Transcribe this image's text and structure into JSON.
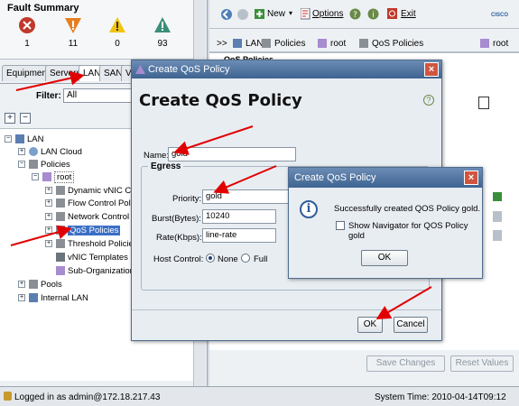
{
  "fault_summary": {
    "title": "Fault Summary",
    "items": [
      {
        "icon": "critical-icon",
        "count": "1",
        "color": "#c0392b"
      },
      {
        "icon": "major-icon",
        "count": "11",
        "color": "#e67e22"
      },
      {
        "icon": "minor-icon",
        "count": "0",
        "color": "#f1c40f"
      },
      {
        "icon": "warning-icon",
        "count": "93",
        "color": "#3a8f7a"
      }
    ]
  },
  "nav_tabs": [
    "Equipment",
    "Servers",
    "LAN",
    "SAN",
    "V"
  ],
  "filter": {
    "label": "Filter:",
    "value": "All"
  },
  "tree": [
    {
      "label": "LAN",
      "level": 0,
      "toggle": "-"
    },
    {
      "label": "LAN Cloud",
      "level": 1,
      "toggle": "+"
    },
    {
      "label": "Policies",
      "level": 1,
      "toggle": "-"
    },
    {
      "label": "root",
      "level": 2,
      "toggle": "-"
    },
    {
      "label": "Dynamic vNIC Cor",
      "level": 3,
      "toggle": "+"
    },
    {
      "label": "Flow Control Polic",
      "level": 3,
      "toggle": "+"
    },
    {
      "label": "Network Control P",
      "level": 3,
      "toggle": "+"
    },
    {
      "label": "QoS Policies",
      "level": 3,
      "toggle": "+",
      "selected": true
    },
    {
      "label": "Threshold Policies",
      "level": 3,
      "toggle": "+"
    },
    {
      "label": "vNIC Templates",
      "level": 3,
      "toggle": ""
    },
    {
      "label": "Sub-Organizations",
      "level": 3,
      "toggle": ""
    },
    {
      "label": "Pools",
      "level": 1,
      "toggle": "+"
    },
    {
      "label": "Internal LAN",
      "level": 1,
      "toggle": "+"
    }
  ],
  "toolbar": {
    "new": "New",
    "options": "Options",
    "exit": "Exit",
    "brand": "CISCO"
  },
  "breadcrumb": {
    "prefix": ">>",
    "items": [
      "LAN",
      "Policies",
      "root",
      "QoS Policies"
    ],
    "right": "root"
  },
  "right_header": "QoS Policies",
  "right_buttons": {
    "save": "Save Changes",
    "reset": "Reset Values"
  },
  "qos_dialog": {
    "title": "Create QoS Policy",
    "header": "Create QoS Policy",
    "name_label": "Name:",
    "name_value": "gold",
    "egress_label": "Egress",
    "priority_label": "Priority:",
    "priority_value": "gold",
    "burst_label": "Burst(Bytes):",
    "burst_value": "10240",
    "rate_label": "Rate(Kbps):",
    "rate_value": "line-rate",
    "host_control_label": "Host Control:",
    "host_none": "None",
    "host_full": "Full",
    "ok": "OK",
    "cancel": "Cancel"
  },
  "msg_dialog": {
    "title": "Create QoS Policy",
    "message": "Successfully created QOS Policy gold.",
    "checkbox_label": "Show Navigator for QOS Policy gold",
    "ok": "OK"
  },
  "status": {
    "login": "Logged in as admin@172.18.217.43",
    "time": "System Time: 2010-04-14T09:12"
  },
  "accent": "#e10000"
}
